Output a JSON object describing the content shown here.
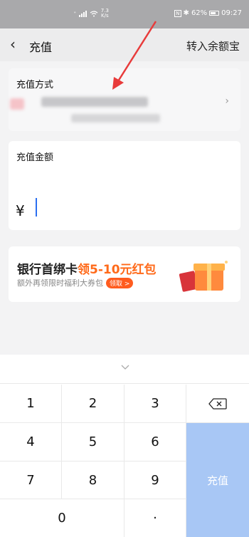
{
  "status_bar": {
    "speed_value": "7.3",
    "speed_unit": "K/s",
    "nfc": "N",
    "bluetooth": "✱",
    "battery": "62%",
    "time": "09:27"
  },
  "nav": {
    "back_icon": "‹",
    "title": "充值",
    "right_link": "转入余额宝"
  },
  "payment": {
    "label": "充值方式",
    "chevron": "›"
  },
  "amount": {
    "label": "充值金额",
    "currency": "¥"
  },
  "promo": {
    "title_prefix": "银行首绑卡",
    "title_highlight": "领5-10元红包",
    "subtitle": "额外再领限时福利大券包",
    "badge": "领取 >",
    "gift_icon": "gift-icon"
  },
  "keypad": {
    "collapse_icon": "chevron-down-icon",
    "keys": [
      "1",
      "2",
      "3",
      "4",
      "5",
      "6",
      "7",
      "8",
      "9",
      "0",
      "·"
    ],
    "delete_icon": "backspace-icon",
    "submit": "充值",
    "submit_color": "#a8c7f5"
  }
}
